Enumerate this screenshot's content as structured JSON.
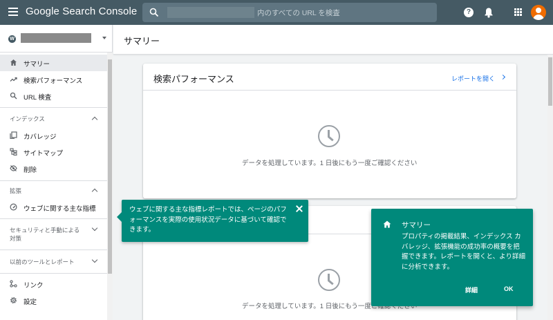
{
  "topbar": {
    "app_title": "Google Search Console",
    "search_placeholder": "内のすべての URL を検査",
    "help_glyph": "?"
  },
  "sidebar": {
    "property_icon_letter": "W",
    "items": [
      {
        "label": "サマリー",
        "icon": "home-icon",
        "active": true
      },
      {
        "label": "検索パフォーマンス",
        "icon": "trending-up-icon"
      },
      {
        "label": "URL 検査",
        "icon": "search-icon"
      }
    ],
    "index_section": {
      "header": "インデックス",
      "items": [
        {
          "label": "カバレッジ",
          "icon": "copy-icon"
        },
        {
          "label": "サイトマップ",
          "icon": "sitemap-icon"
        },
        {
          "label": "削除",
          "icon": "visibility-off-icon"
        }
      ]
    },
    "enhancements_section": {
      "header": "拡張",
      "items": [
        {
          "label": "ウェブに関する主な指標",
          "icon": "speed-icon"
        }
      ]
    },
    "security_section": {
      "header": "セキュリティと手動による対策"
    },
    "legacy_section": {
      "header": "以前のツールとレポート"
    },
    "bottom_items": [
      {
        "label": "リンク",
        "icon": "links-icon"
      },
      {
        "label": "設定",
        "icon": "settings-icon"
      }
    ]
  },
  "main": {
    "page_title": "サマリー",
    "performance_card": {
      "title": "検索パフォーマンス",
      "link": "レポートを開く",
      "status": "データを処理しています。1 日後にもう一度ご確認ください"
    },
    "second_card": {
      "status": "データを処理しています。1 日後にもう一度ご確認ください"
    }
  },
  "tooltip": {
    "text": "ウェブに関する主な指標レポートでは、ページのパフォーマンスを実際の使用状況データに基づいて確認できます。"
  },
  "dialog": {
    "title": "サマリー",
    "body": "プロパティの掲載結果、インデックス カバレッジ、拡張機能の成功率の概要を把握できます。レポートを開くと、より詳細に分析できます。",
    "detail_button": "詳細",
    "ok_button": "OK"
  },
  "colors": {
    "topbar": "#455a64",
    "accent_teal": "#00897b",
    "link_blue": "#1a73e8",
    "avatar": "#ef6c00"
  }
}
